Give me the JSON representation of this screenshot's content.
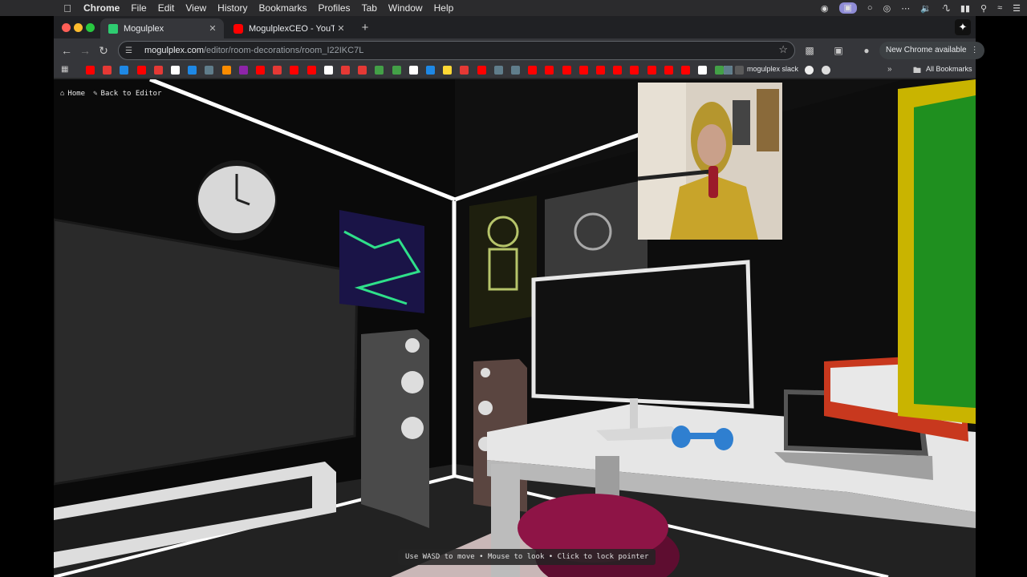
{
  "menubar": {
    "app": "Chrome",
    "items": [
      "File",
      "Edit",
      "View",
      "History",
      "Bookmarks",
      "Profiles",
      "Tab",
      "Window",
      "Help"
    ]
  },
  "tabs": [
    {
      "title": "Mogulplex",
      "favicon_color": "#2ecc71",
      "active": true
    },
    {
      "title": "MogulplexCEO - YouTube",
      "favicon_color": "#ff0000",
      "active": false
    }
  ],
  "toolbar": {
    "url_host": "mogulplex.com",
    "url_path": "/editor/room-decorations/room_I22IKC7L",
    "new_chrome_label": "New Chrome available"
  },
  "bookmarks": {
    "named": [
      {
        "label": "mogulplex slack"
      }
    ],
    "all_label": "All Bookmarks"
  },
  "overlay": {
    "home_label": "Home",
    "back_label": "Back to Editor",
    "hint": "Use WASD to move • Mouse to look • Click to lock pointer"
  },
  "colors": {
    "youtube_red": "#ff0000",
    "accent_green": "#1f8f1f",
    "accent_yellow": "#c9b400",
    "laptop_red": "#c8381e",
    "pouf_magenta": "#8e1446",
    "dumbbell_blue": "#2f7fd0"
  }
}
